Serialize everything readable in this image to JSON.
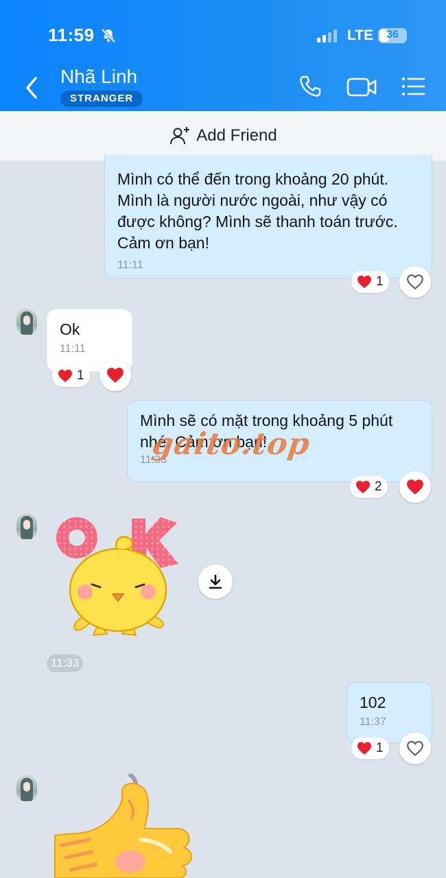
{
  "status_bar": {
    "time": "11:59",
    "network": "LTE",
    "battery": "36"
  },
  "header": {
    "contact_name": "Nhã Linh",
    "badge": "STRANGER"
  },
  "add_friend": {
    "label": "Add Friend"
  },
  "messages": [
    {
      "direction": "outgoing",
      "text": "Mình có thể đến trong khoảng 20 phút. Mình là người nước ngoài, như vậy có được không? Mình sẽ thanh toán trước. Cảm ơn bạn!",
      "time": "11:11",
      "reaction_count": "1"
    },
    {
      "direction": "incoming",
      "text": "Ok",
      "time": "11:11",
      "reaction_count": "1"
    },
    {
      "direction": "outgoing",
      "text": "Mình sẽ có mặt trong khoảng 5 phút nhé. Cảm ơn bạn!",
      "time": "11:33",
      "reaction_count": "2"
    },
    {
      "direction": "incoming",
      "type": "sticker",
      "sticker_text": "OK",
      "time": "11:33"
    },
    {
      "direction": "outgoing",
      "text": "102",
      "time": "11:37",
      "reaction_count": "1"
    },
    {
      "direction": "incoming",
      "type": "sticker",
      "sticker": "thumbs-up"
    }
  ],
  "watermark": "gaito.top",
  "colors": {
    "header_blue": "#1a8cf5",
    "outgoing_bubble": "#d5eeff",
    "incoming_bubble": "#ffffff",
    "background": "#dde3eb",
    "heart_red": "#e8202f"
  },
  "icons": [
    "bell-off-icon",
    "signal-icon",
    "back-icon",
    "phone-icon",
    "video-icon",
    "list-menu-icon",
    "add-person-icon",
    "heart-icon",
    "heart-outline-icon",
    "download-icon"
  ]
}
